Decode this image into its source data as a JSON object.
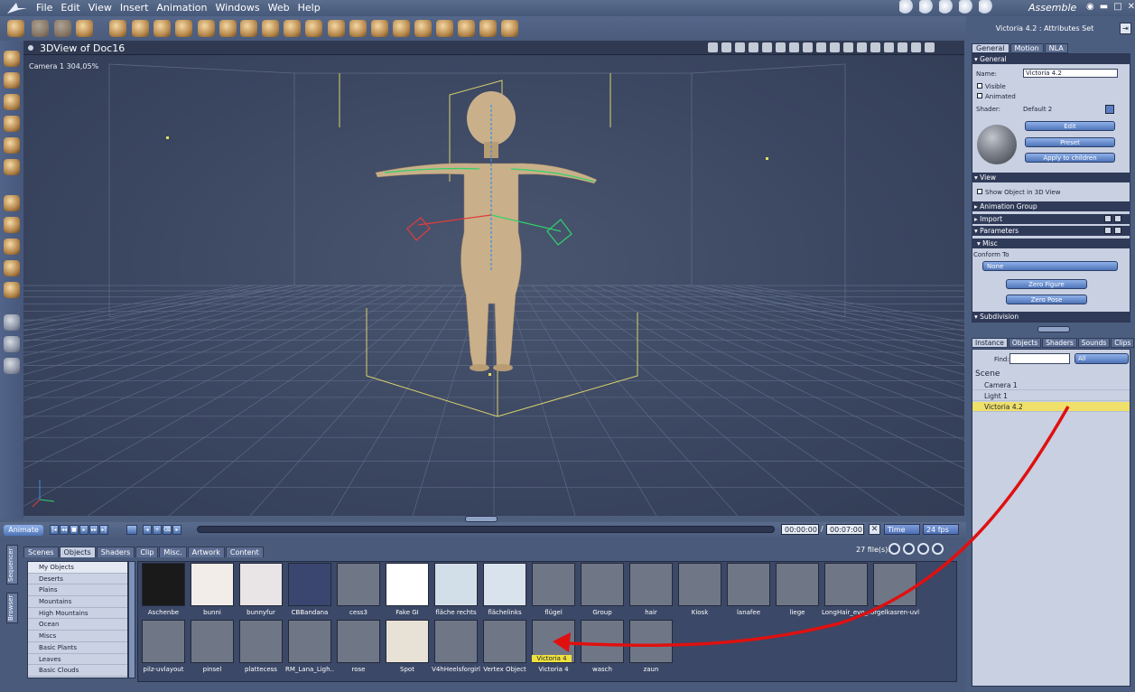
{
  "menubar": {
    "items": [
      "File",
      "Edit",
      "View",
      "Insert",
      "Animation",
      "Windows",
      "Web",
      "Help"
    ],
    "room": "Assemble"
  },
  "viewport": {
    "title": "3DView of Doc16",
    "camera_label": "Camera 1 304,05%"
  },
  "timeline": {
    "animate_label": "Animate",
    "start_time": "00:00:00",
    "separator": "/",
    "end_time": "00:07:00",
    "time_mode": "Time",
    "fps": "24 fps"
  },
  "browser": {
    "tabs": [
      "Scenes",
      "Objects",
      "Shaders",
      "Clip",
      "Misc.",
      "Artwork",
      "Content"
    ],
    "active_tab": "Objects",
    "side_tabs": [
      "Sequencer",
      "Browser"
    ],
    "file_count": "27 file(s).",
    "categories": [
      "My Objects",
      "Deserts",
      "Plains",
      "Mountains",
      "High Mountains",
      "Ocean",
      "Miscs",
      "Basic Plants",
      "Leaves",
      "Basic Clouds"
    ],
    "thumbs_row1": [
      "Aschenbe",
      "bunni",
      "bunnyfur",
      "CBBandana",
      "cess3",
      "Fake GI",
      "fläche rechts",
      "flächelinks",
      "flügel",
      "Group",
      "hair",
      "Kiosk",
      "lanafee",
      "liege",
      "LongHair_evo_...",
      "orgelkasren-uvl..."
    ],
    "thumbs_row2": [
      "pilz-uvlayout",
      "pinsel",
      "plattecess",
      "RM_Lana_Ligh...",
      "rose",
      "Spot",
      "V4hHeelsforgirl",
      "Vertex Object",
      "Victoria 4",
      "wasch",
      "zaun"
    ],
    "drag_label": "Victoria 4"
  },
  "attributes": {
    "title": "Victoria 4.2 : Attributes Set",
    "tabs": [
      "General",
      "Motion",
      "NLA"
    ],
    "general_header": "General",
    "name_label": "Name:",
    "name_value": "Victoria 4.2",
    "visible_label": "Visible",
    "animated_label": "Animated",
    "shader_label": "Shader:",
    "shader_value": "Default 2",
    "edit_btn": "Edit",
    "preset_btn": "Preset",
    "apply_btn": "Apply to children",
    "view_header": "View",
    "show_obj_label": "Show Object in 3D View",
    "anim_group_header": "Animation Group",
    "import_header": "Import",
    "parameters_header": "Parameters",
    "misc_header": "Misc",
    "conform_label": "Conform To",
    "conform_value": "None",
    "zero_figure_btn": "Zero Figure",
    "zero_pose_btn": "Zero Pose",
    "subdivision_header": "Subdivision"
  },
  "instances": {
    "tabs": [
      "Instance",
      "Objects",
      "Shaders",
      "Sounds",
      "Clips"
    ],
    "find_label": "Find:",
    "filter_value": "All",
    "scene_label": "Scene",
    "rows": [
      "Camera 1",
      "Light 1",
      "Victoria 4.2"
    ]
  },
  "colors": {
    "arrow": "#e01010",
    "highlight": "#efe06a",
    "grid": "#6f7c96",
    "skin": "#c9b08a"
  }
}
